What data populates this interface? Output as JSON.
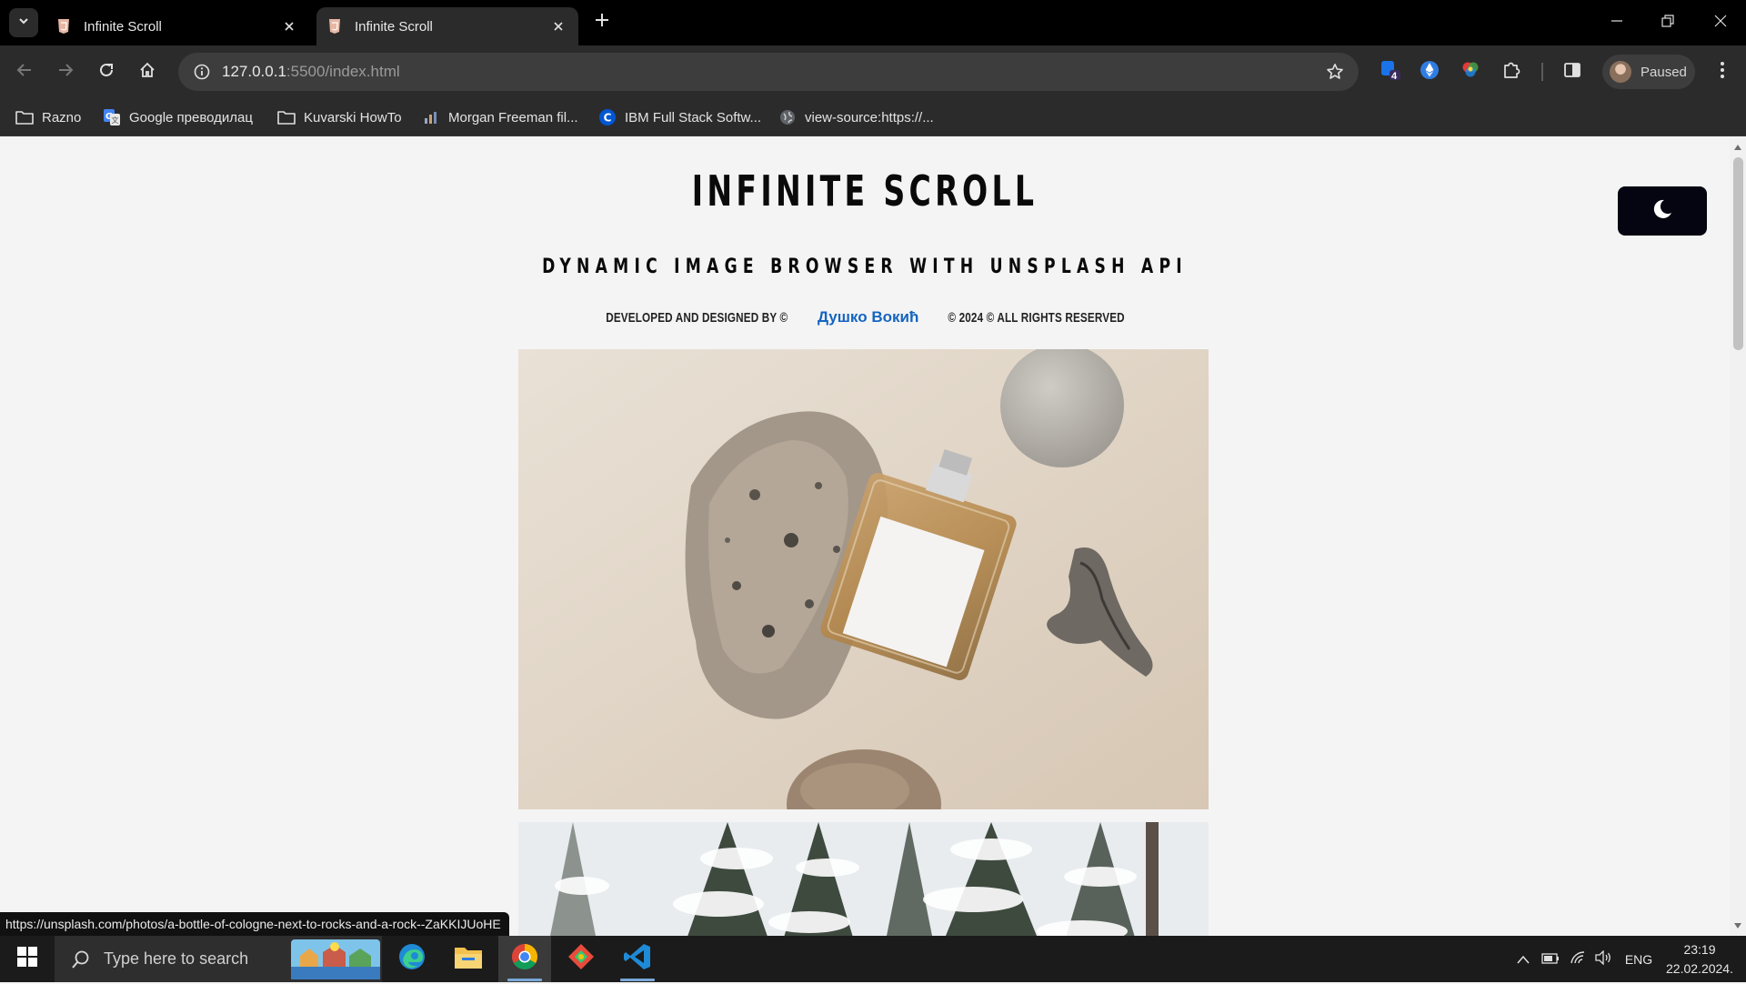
{
  "browser": {
    "tabs": [
      {
        "title": "Infinite Scroll",
        "active": false
      },
      {
        "title": "Infinite Scroll",
        "active": true
      }
    ],
    "url_host": "127.0.0.1",
    "url_rest": ":5500/index.html",
    "profile_label": "Paused",
    "extension_badge": "4",
    "bookmarks": [
      {
        "label": "Razno",
        "icon": "folder-icon"
      },
      {
        "label": "Google преводилац",
        "icon": "google-translate-icon"
      },
      {
        "label": "Kuvarski HowTo",
        "icon": "folder-icon"
      },
      {
        "label": "Morgan Freeman fil...",
        "icon": "bars-icon"
      },
      {
        "label": "IBM Full Stack Softw...",
        "icon": "coursera-icon"
      },
      {
        "label": "view-source:https://...",
        "icon": "globe-icon"
      }
    ]
  },
  "page": {
    "title": "INFINITE SCROLL",
    "subtitle": "DYNAMIC IMAGE BROWSER WITH UNSPLASH API",
    "credit_prefix": "DEVELOPED AND DESIGNED BY ©",
    "credit_author": "Душко Вокић",
    "credit_suffix": "© 2024 © ALL RIGHTS RESERVED",
    "theme_toggle_icon": "moon-icon",
    "images": [
      {
        "subject": "a bottle of cologne next to rocks and a rock"
      },
      {
        "subject": "snow covered pine trees"
      }
    ]
  },
  "status_bar_url": "https://unsplash.com/photos/a-bottle-of-cologne-next-to-rocks-and-a-rock--ZaKKIJUoHE",
  "taskbar": {
    "search_placeholder": "Type here to search",
    "apps": [
      "edge-icon",
      "file-explorer-icon",
      "chrome-icon",
      "git-icon",
      "vscode-icon"
    ],
    "language": "ENG",
    "time": "23:19",
    "date": "22.02.2024."
  },
  "colors": {
    "accent_link": "#1565c0",
    "theme_button": "#050512",
    "page_background": "#f4f4f4"
  }
}
